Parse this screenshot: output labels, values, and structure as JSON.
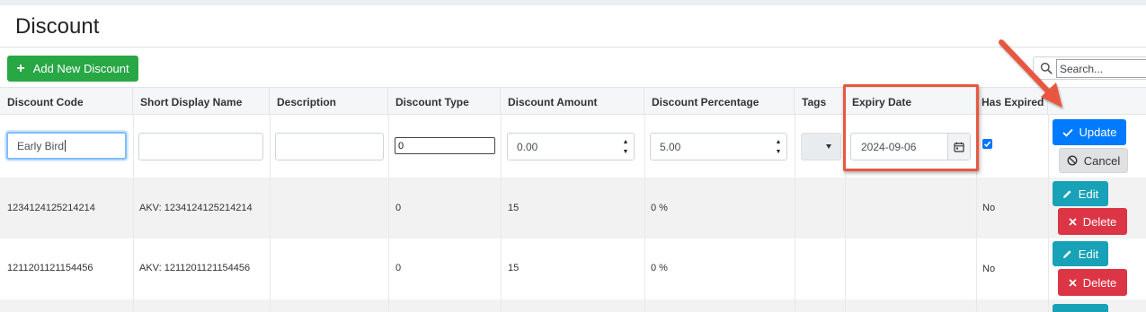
{
  "page": {
    "title": "Discount"
  },
  "toolbar": {
    "add_label": "Add New Discount",
    "search_placeholder": "Search..."
  },
  "columns": [
    "Discount Code",
    "Short Display Name",
    "Description",
    "Discount Type",
    "Discount Amount",
    "Discount Percentage",
    "Tags",
    "Expiry Date",
    "Has Expired"
  ],
  "edit_row": {
    "code": "Early Bird",
    "short_display_name": "",
    "description": "",
    "discount_type": "0",
    "discount_amount": "0.00",
    "discount_percentage": "5.00",
    "tags": "",
    "expiry_date": "2024-09-06",
    "has_expired": true,
    "update_label": "Update",
    "cancel_label": "Cancel"
  },
  "rows": [
    {
      "code": "1234124125214214",
      "short_display_name": "AKV: 1234124125214214",
      "description": "",
      "discount_type": "0",
      "discount_amount": "15",
      "discount_percentage": "0 %",
      "tags": "",
      "expiry_date": "",
      "has_expired": "No",
      "edit_label": "Edit",
      "delete_label": "Delete"
    },
    {
      "code": "1211201121154456",
      "short_display_name": "AKV: 1211201121154456",
      "description": "",
      "discount_type": "0",
      "discount_amount": "15",
      "discount_percentage": "0 %",
      "tags": "",
      "expiry_date": "",
      "has_expired": "No",
      "edit_label": "Edit",
      "delete_label": "Delete"
    }
  ],
  "annotation": {
    "color": "#e8573f"
  },
  "colors": {
    "add": "#28a745",
    "update": "#007bff",
    "edit": "#17a2b8",
    "delete": "#dc3545"
  }
}
